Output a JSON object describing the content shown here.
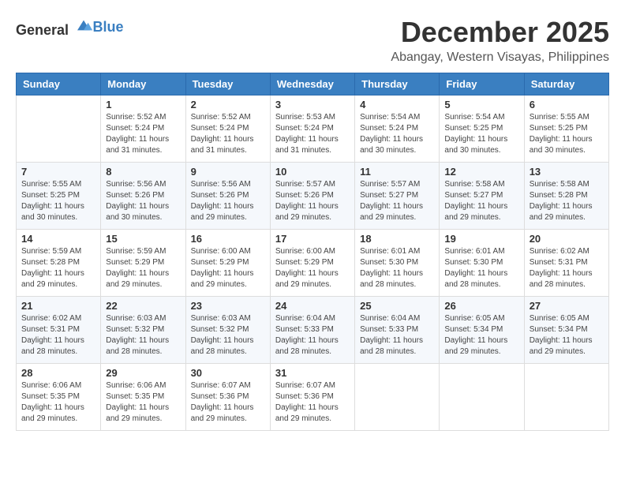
{
  "logo": {
    "general": "General",
    "blue": "Blue"
  },
  "title": "December 2025",
  "location": "Abangay, Western Visayas, Philippines",
  "weekdays": [
    "Sunday",
    "Monday",
    "Tuesday",
    "Wednesday",
    "Thursday",
    "Friday",
    "Saturday"
  ],
  "weeks": [
    [
      {
        "day": "",
        "info": ""
      },
      {
        "day": "1",
        "info": "Sunrise: 5:52 AM\nSunset: 5:24 PM\nDaylight: 11 hours\nand 31 minutes."
      },
      {
        "day": "2",
        "info": "Sunrise: 5:52 AM\nSunset: 5:24 PM\nDaylight: 11 hours\nand 31 minutes."
      },
      {
        "day": "3",
        "info": "Sunrise: 5:53 AM\nSunset: 5:24 PM\nDaylight: 11 hours\nand 31 minutes."
      },
      {
        "day": "4",
        "info": "Sunrise: 5:54 AM\nSunset: 5:24 PM\nDaylight: 11 hours\nand 30 minutes."
      },
      {
        "day": "5",
        "info": "Sunrise: 5:54 AM\nSunset: 5:25 PM\nDaylight: 11 hours\nand 30 minutes."
      },
      {
        "day": "6",
        "info": "Sunrise: 5:55 AM\nSunset: 5:25 PM\nDaylight: 11 hours\nand 30 minutes."
      }
    ],
    [
      {
        "day": "7",
        "info": "Sunrise: 5:55 AM\nSunset: 5:25 PM\nDaylight: 11 hours\nand 30 minutes."
      },
      {
        "day": "8",
        "info": "Sunrise: 5:56 AM\nSunset: 5:26 PM\nDaylight: 11 hours\nand 30 minutes."
      },
      {
        "day": "9",
        "info": "Sunrise: 5:56 AM\nSunset: 5:26 PM\nDaylight: 11 hours\nand 29 minutes."
      },
      {
        "day": "10",
        "info": "Sunrise: 5:57 AM\nSunset: 5:26 PM\nDaylight: 11 hours\nand 29 minutes."
      },
      {
        "day": "11",
        "info": "Sunrise: 5:57 AM\nSunset: 5:27 PM\nDaylight: 11 hours\nand 29 minutes."
      },
      {
        "day": "12",
        "info": "Sunrise: 5:58 AM\nSunset: 5:27 PM\nDaylight: 11 hours\nand 29 minutes."
      },
      {
        "day": "13",
        "info": "Sunrise: 5:58 AM\nSunset: 5:28 PM\nDaylight: 11 hours\nand 29 minutes."
      }
    ],
    [
      {
        "day": "14",
        "info": "Sunrise: 5:59 AM\nSunset: 5:28 PM\nDaylight: 11 hours\nand 29 minutes."
      },
      {
        "day": "15",
        "info": "Sunrise: 5:59 AM\nSunset: 5:29 PM\nDaylight: 11 hours\nand 29 minutes."
      },
      {
        "day": "16",
        "info": "Sunrise: 6:00 AM\nSunset: 5:29 PM\nDaylight: 11 hours\nand 29 minutes."
      },
      {
        "day": "17",
        "info": "Sunrise: 6:00 AM\nSunset: 5:29 PM\nDaylight: 11 hours\nand 29 minutes."
      },
      {
        "day": "18",
        "info": "Sunrise: 6:01 AM\nSunset: 5:30 PM\nDaylight: 11 hours\nand 28 minutes."
      },
      {
        "day": "19",
        "info": "Sunrise: 6:01 AM\nSunset: 5:30 PM\nDaylight: 11 hours\nand 28 minutes."
      },
      {
        "day": "20",
        "info": "Sunrise: 6:02 AM\nSunset: 5:31 PM\nDaylight: 11 hours\nand 28 minutes."
      }
    ],
    [
      {
        "day": "21",
        "info": "Sunrise: 6:02 AM\nSunset: 5:31 PM\nDaylight: 11 hours\nand 28 minutes."
      },
      {
        "day": "22",
        "info": "Sunrise: 6:03 AM\nSunset: 5:32 PM\nDaylight: 11 hours\nand 28 minutes."
      },
      {
        "day": "23",
        "info": "Sunrise: 6:03 AM\nSunset: 5:32 PM\nDaylight: 11 hours\nand 28 minutes."
      },
      {
        "day": "24",
        "info": "Sunrise: 6:04 AM\nSunset: 5:33 PM\nDaylight: 11 hours\nand 28 minutes."
      },
      {
        "day": "25",
        "info": "Sunrise: 6:04 AM\nSunset: 5:33 PM\nDaylight: 11 hours\nand 28 minutes."
      },
      {
        "day": "26",
        "info": "Sunrise: 6:05 AM\nSunset: 5:34 PM\nDaylight: 11 hours\nand 29 minutes."
      },
      {
        "day": "27",
        "info": "Sunrise: 6:05 AM\nSunset: 5:34 PM\nDaylight: 11 hours\nand 29 minutes."
      }
    ],
    [
      {
        "day": "28",
        "info": "Sunrise: 6:06 AM\nSunset: 5:35 PM\nDaylight: 11 hours\nand 29 minutes."
      },
      {
        "day": "29",
        "info": "Sunrise: 6:06 AM\nSunset: 5:35 PM\nDaylight: 11 hours\nand 29 minutes."
      },
      {
        "day": "30",
        "info": "Sunrise: 6:07 AM\nSunset: 5:36 PM\nDaylight: 11 hours\nand 29 minutes."
      },
      {
        "day": "31",
        "info": "Sunrise: 6:07 AM\nSunset: 5:36 PM\nDaylight: 11 hours\nand 29 minutes."
      },
      {
        "day": "",
        "info": ""
      },
      {
        "day": "",
        "info": ""
      },
      {
        "day": "",
        "info": ""
      }
    ]
  ]
}
